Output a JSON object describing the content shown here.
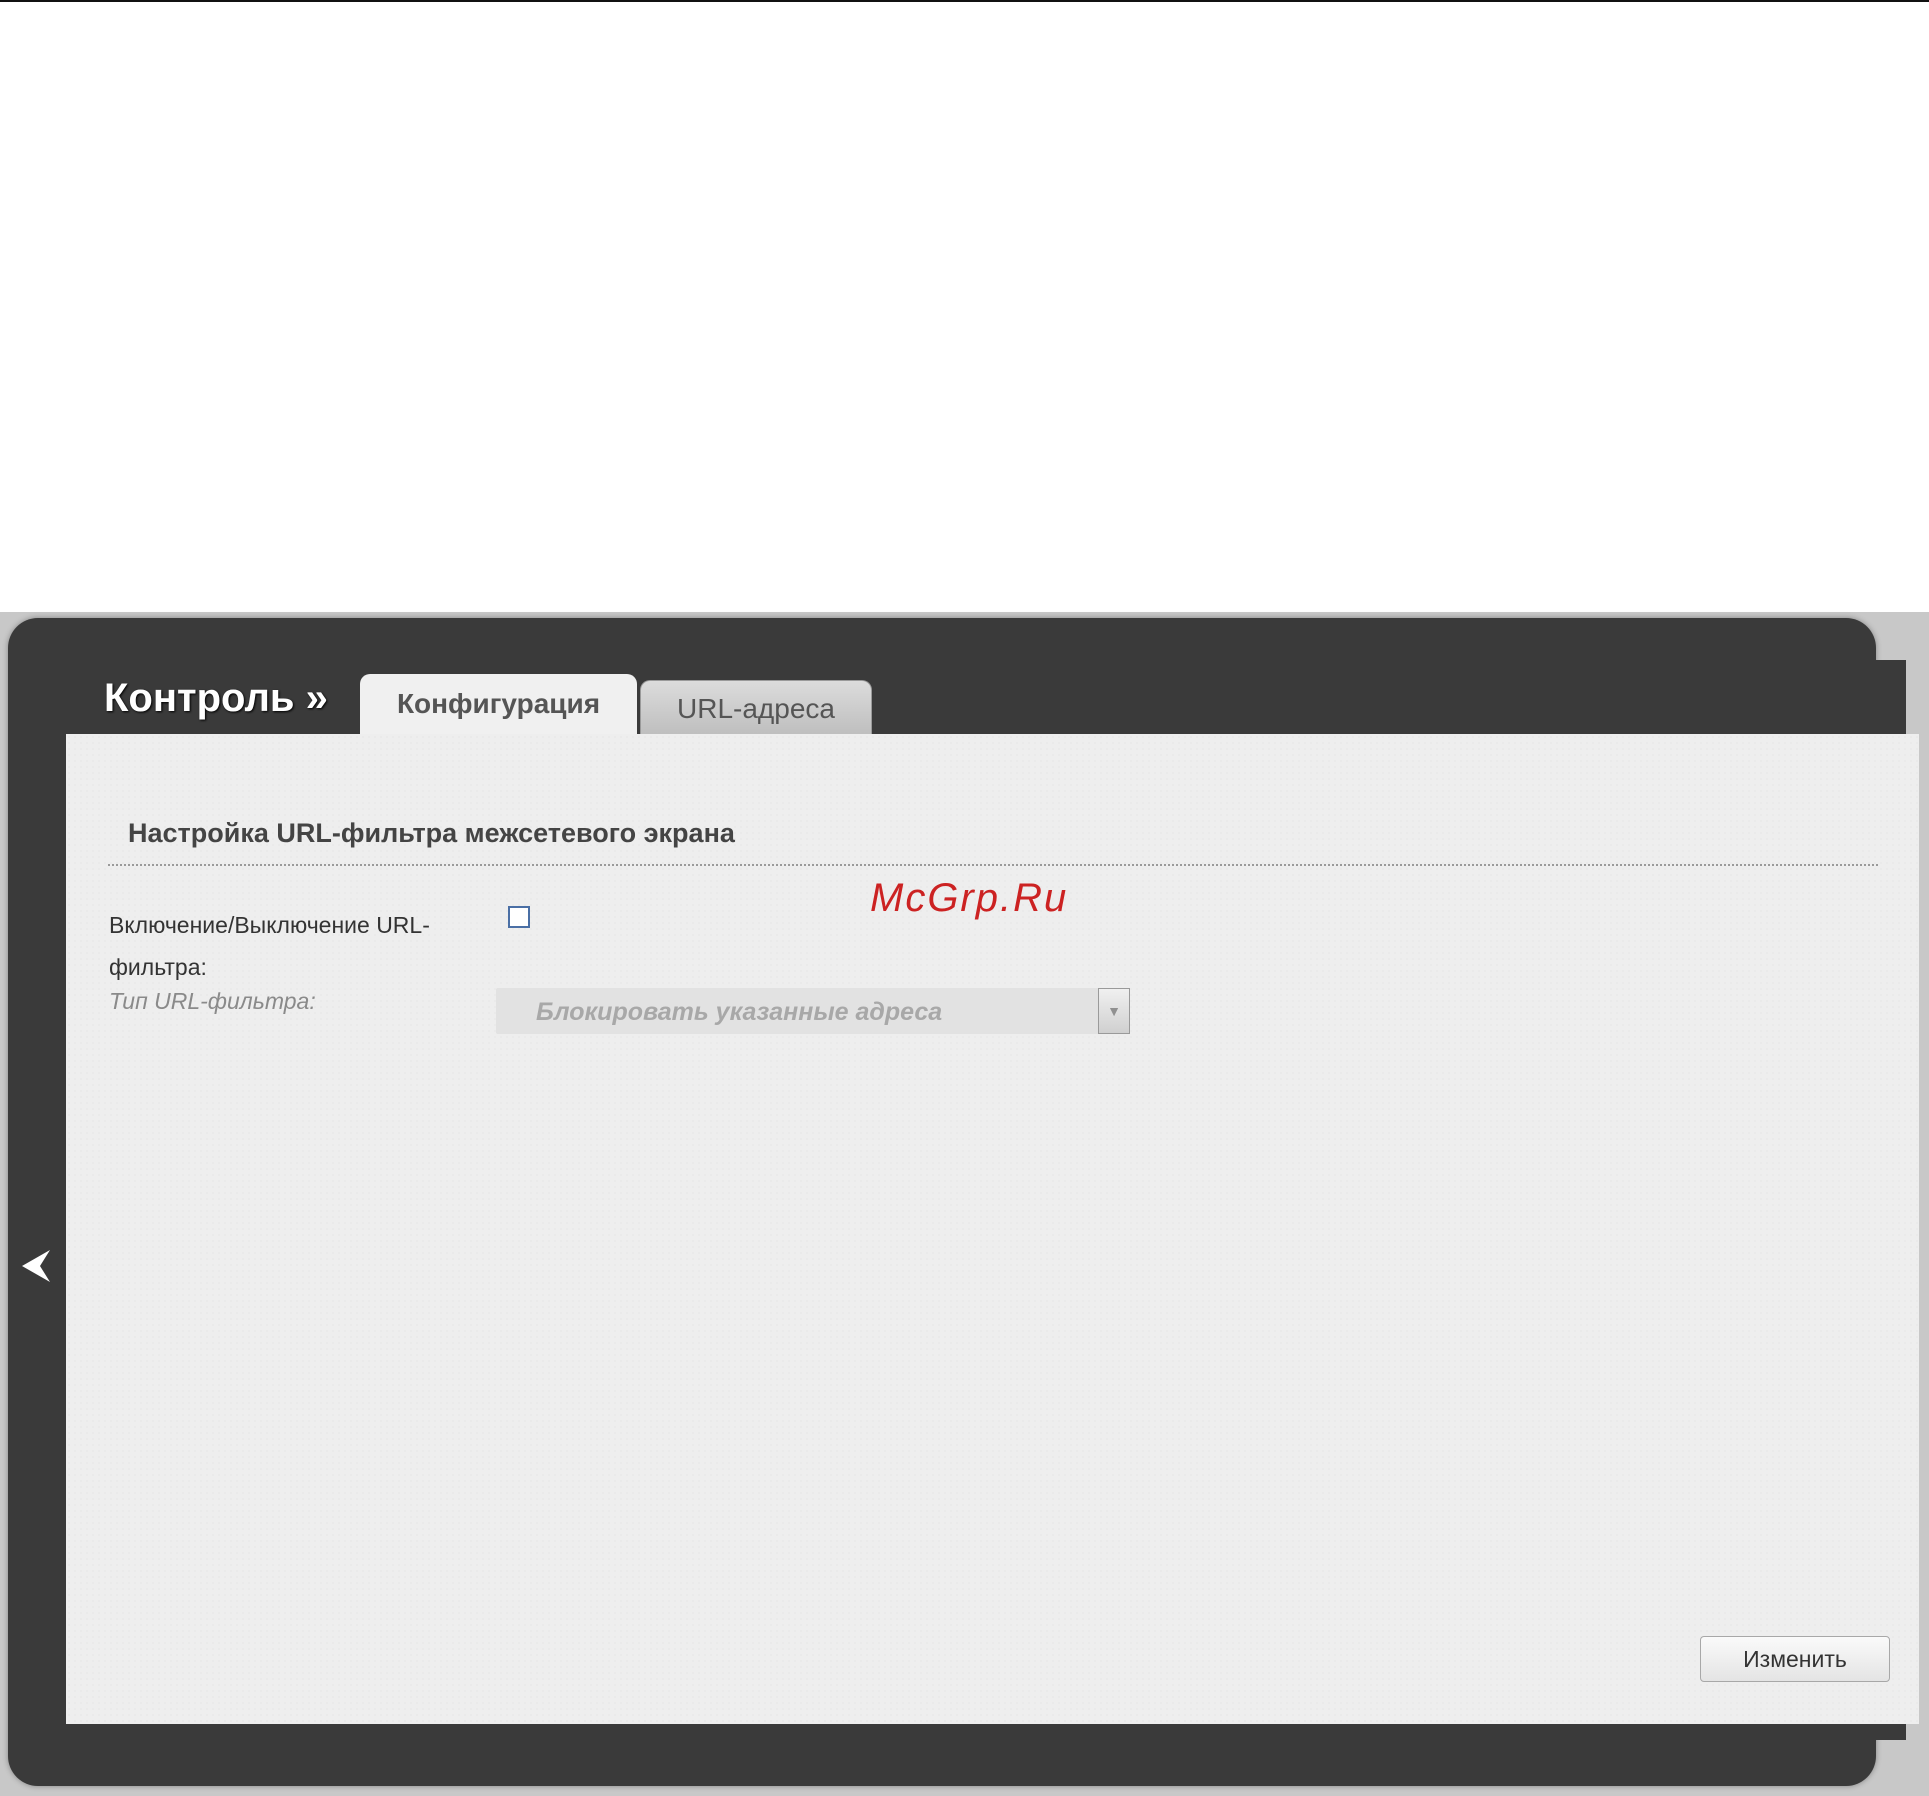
{
  "header": {
    "section_title": "Контроль »",
    "tabs": [
      {
        "label": "Конфигурация",
        "active": true
      },
      {
        "label": "URL-адреса",
        "active": false
      }
    ]
  },
  "form": {
    "heading": "Настройка URL-фильтра межсетевого экрана",
    "enable_label": "Включение/Выключение URL-фильтра:",
    "enable_checked": false,
    "type_label": "Тип URL-фильтра:",
    "type_value": "Блокировать указанные адреса"
  },
  "actions": {
    "apply_label": "Изменить"
  },
  "watermark": "McGrp.Ru",
  "icons": {
    "back": "back-arrow-icon",
    "dropdown": "chevron-down-icon"
  },
  "colors": {
    "panel": "#3a3a3a",
    "content_bg": "#eeeeee",
    "watermark": "#cc2222",
    "checkbox_border": "#4a6fa5"
  }
}
